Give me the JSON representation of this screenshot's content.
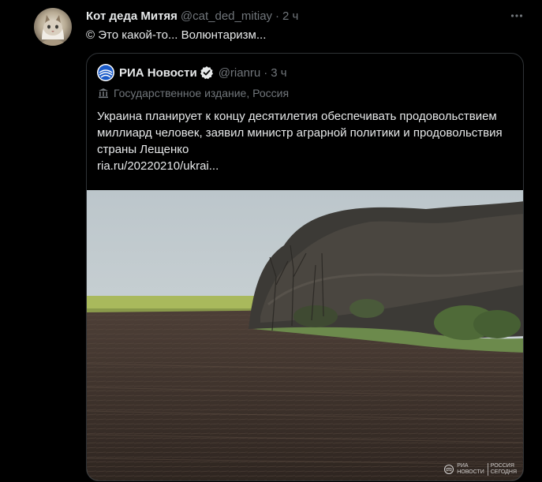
{
  "tweet": {
    "author_name": "Кот деда Митяя",
    "author_handle": "@cat_ded_mitiay",
    "separator": "·",
    "time": "2 ч",
    "text": "© Это какой-то... Волюнтаризм..."
  },
  "quote": {
    "author_name": "РИА Новости",
    "author_handle": "@rianru",
    "separator": "·",
    "time": "3 ч",
    "label": "Государственное издание, Россия",
    "body": "Украина планирует к концу десятилетия обеспечивать продовольствием миллиард человек, заявил министр аграрной политики и продовольствия страны Лещенко",
    "link": "ria.ru/20220210/ukrai..."
  },
  "watermark": {
    "line1": "РИА",
    "line2": "НОВОСТИ",
    "line3": "РОССИЯ",
    "line4": "СЕГОДНЯ"
  },
  "icons": {
    "more": "more-options-icon",
    "verified": "verified-badge-icon",
    "label": "government-building-icon",
    "logo": "ria-logo-icon"
  },
  "colors": {
    "background": "#000000",
    "text": "#e7e9ea",
    "secondary": "#71767b",
    "border": "#2f3336",
    "verified": "#1d9bf0"
  }
}
